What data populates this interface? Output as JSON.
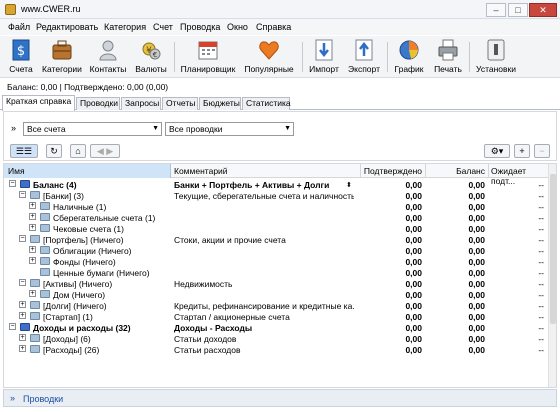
{
  "window": {
    "title": "www.CWER.ru"
  },
  "menu": [
    "Файл",
    "Редактировать",
    "Категория",
    "Счет",
    "Проводка",
    "Окно",
    "Справка"
  ],
  "toolbar": {
    "accounts": "Счета",
    "categories": "Категории",
    "contacts": "Контакты",
    "currencies": "Валюты",
    "scheduler": "Планировщик",
    "popular": "Популярные",
    "import": "Импорт",
    "export": "Экспорт",
    "chart": "График",
    "print": "Печать",
    "settings": "Установки"
  },
  "balance_text": "Баланс: 0,00 | Подтверждено: 0,00 (0,00)",
  "tabs": [
    "Краткая справка",
    "Проводки",
    "Запросы",
    "Отчеты",
    "Бюджеты",
    "Статистика"
  ],
  "filters": {
    "accounts": "Все счета",
    "transactions": "Все проводки"
  },
  "columns": {
    "name": "Имя",
    "comment": "Комментарий",
    "confirmed": "Подтверждено",
    "balance": "Баланс",
    "expected": "Ожидает подт..."
  },
  "rows": [
    {
      "name": "Баланс (4)",
      "comment": "Банки + Портфель + Активы + Долги",
      "c": "0,00",
      "b": "0,00",
      "e": "--"
    },
    {
      "name": "[Банки] (3)",
      "comment": "Текущие, сберегательные счета и наличность",
      "c": "0,00",
      "b": "0,00",
      "e": "--"
    },
    {
      "name": "Наличные (1)",
      "comment": "",
      "c": "0,00",
      "b": "0,00",
      "e": "--"
    },
    {
      "name": "Сберегательные счета (1)",
      "comment": "",
      "c": "0,00",
      "b": "0,00",
      "e": "--"
    },
    {
      "name": "Чековые счета (1)",
      "comment": "",
      "c": "0,00",
      "b": "0,00",
      "e": "--"
    },
    {
      "name": "[Портфель] (Ничего)",
      "comment": "Стоки, акции и прочие счета",
      "c": "0,00",
      "b": "0,00",
      "e": "--"
    },
    {
      "name": "Облигации (Ничего)",
      "comment": "",
      "c": "0,00",
      "b": "0,00",
      "e": "--"
    },
    {
      "name": "Фонды (Ничего)",
      "comment": "",
      "c": "0,00",
      "b": "0,00",
      "e": "--"
    },
    {
      "name": "Ценные бумаги (Ничего)",
      "comment": "",
      "c": "0,00",
      "b": "0,00",
      "e": "--"
    },
    {
      "name": "[Активы] (Ничего)",
      "comment": "Недвижимость",
      "c": "0,00",
      "b": "0,00",
      "e": "--"
    },
    {
      "name": "Дом (Ничего)",
      "comment": "",
      "c": "0,00",
      "b": "0,00",
      "e": "--"
    },
    {
      "name": "[Долги] (Ничего)",
      "comment": "Кредиты, рефинансирование и кредитные ка...",
      "c": "0,00",
      "b": "0,00",
      "e": "--"
    },
    {
      "name": "[Стартап] (1)",
      "comment": "Стартап / акционерные счета",
      "c": "0,00",
      "b": "0,00",
      "e": "--"
    },
    {
      "name": "Доходы и расходы (32)",
      "comment": "Доходы - Расходы",
      "c": "0,00",
      "b": "0,00",
      "e": "--"
    },
    {
      "name": "[Доходы] (6)",
      "comment": "Статьи доходов",
      "c": "0,00",
      "b": "0,00",
      "e": "--"
    },
    {
      "name": "[Расходы] (26)",
      "comment": "Статьи расходов",
      "c": "0,00",
      "b": "0,00",
      "e": "--"
    }
  ],
  "footer": {
    "label": "Проводки"
  }
}
